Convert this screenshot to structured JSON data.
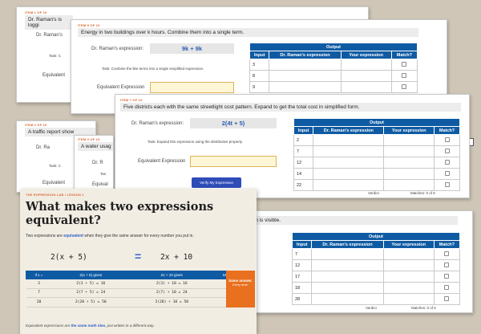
{
  "card1": {
    "item_tag": "ITEM 1 OF 10",
    "prompt": "Dr. Raman's is loggi",
    "expression_label": "Dr. Raman's",
    "task_label": "Task: C",
    "equivalent_label": "Equivalent"
  },
  "card2": {
    "item_tag": "ITEM 5 OF 10",
    "prompt": "Energy in two buildings over k hours. Combine them into a single term.",
    "expression_label": "Dr. Raman's expression:",
    "expression": "9k + 9k",
    "task": "Task: Combine the like terms into a single simplified expression.",
    "equivalent_label": "Equivalent Expression",
    "table": {
      "title": "Output",
      "headers": [
        "Input",
        "Dr. Raman's expression",
        "Your expression",
        "Match?"
      ],
      "inputs": [
        "3",
        "8",
        "9"
      ]
    }
  },
  "card3": {
    "item_tag": "ITEM 2 OF 10",
    "prompt": "A traffic report show",
    "expression_label": "Dr. Ra",
    "task_label": "Task: C",
    "equivalent_label": "Equivalent"
  },
  "card4": {
    "item_tag": "ITEM 3 OF 10",
    "prompt": "A water usag",
    "expression_label": "Dr. R",
    "task_label": "Tas",
    "equivalent_label": "Equival"
  },
  "card5": {
    "item_tag": "ITEM 7 OF 10",
    "prompt": "Five districts each with the same streetlight cost pattern. Expand to get the total cost in simplified form.",
    "expression_label": "Dr. Raman's expression:",
    "expression": "2(4t + 5)",
    "task": "Task: Expand this expression using the distributive property",
    "equivalent_label": "Equivalent Expression",
    "verify_button": "Verify My Expression",
    "table": {
      "title": "Output",
      "headers": [
        "Input",
        "Dr. Raman's expression",
        "Your expression",
        "Match?"
      ],
      "inputs": [
        "2",
        "7",
        "12",
        "14",
        "22"
      ]
    },
    "verdict_label": "Verdict",
    "matches": "Matches: 0 of 5"
  },
  "card6": {
    "prompt": "s breakdown is visible.",
    "table": {
      "title": "Output",
      "headers": [
        "Input",
        "Dr. Raman's expression",
        "Your expression",
        "Match?"
      ],
      "inputs": [
        "7",
        "12",
        "17",
        "18",
        "28"
      ]
    },
    "verdict_label": "Verdict",
    "matches": "Matches: 0 of 5"
  },
  "lesson": {
    "crumb": "THE EXPRESSION LAB  /  LESSON 1",
    "title": "What makes two expressions equivalent?",
    "intro_before": "Two expressions are ",
    "intro_highlight": "equivalent",
    "intro_after": " when they give the same answer for every number you put in.",
    "expr_left": "2(x + 5)",
    "equals": "=",
    "expr_right": "2x + 10",
    "table_headers": [
      "if x =",
      "2(x + 5) gives",
      "2x + 10 gives",
      "Match?"
    ],
    "rows": [
      {
        "x": "3",
        "left": "2(3 + 5) = 16",
        "right": "2(3) + 10 = 16",
        "match": "✓"
      },
      {
        "x": "7",
        "left": "2(7 + 5) = 24",
        "right": "2(7) + 10 = 24",
        "match": "✓"
      },
      {
        "x": "20",
        "left": "2(20 + 5) = 50",
        "right": "2(20) + 10 = 50",
        "match": "✓"
      }
    ],
    "side_a": "Same answer.",
    "side_b": "Every time.",
    "footnote_before": "Equivalent expressions are ",
    "footnote_highlight": "the same math idea",
    "footnote_after": ", just written in a different way."
  },
  "colors": {
    "header_blue": "#0f5ba3",
    "accent_orange": "#e8701f",
    "expression_blue": "#2b5fb4",
    "background": "#cfc6b7"
  }
}
